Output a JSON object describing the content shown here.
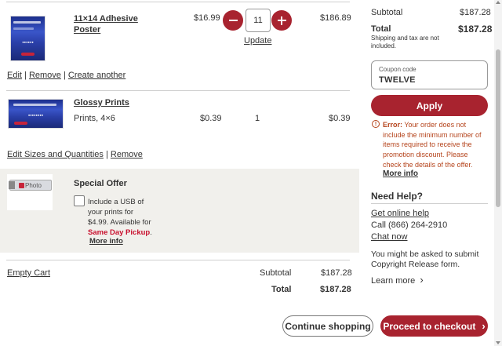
{
  "items": [
    {
      "name": "11×14 Adhesive Poster",
      "name_line1": "11×14 Adhesive",
      "name_line2": "Poster",
      "price": "$16.99",
      "quantity": "11",
      "total": "$186.89",
      "update_label": "Update",
      "actions": [
        "Edit",
        "Remove",
        "Create another"
      ]
    },
    {
      "name": "Glossy Prints",
      "subtitle": "Prints, 4×6",
      "price": "$0.39",
      "quantity": "1",
      "total": "$0.39",
      "actions": [
        "Edit Sizes and Quantities",
        "Remove"
      ]
    }
  ],
  "offer": {
    "badge": "Photo",
    "title": "Special Offer",
    "line1": "Include a USB of",
    "line2": "your prints for",
    "line3": "$4.99. Available for",
    "highlight": "Same Day Pickup",
    "highlight_suffix": ".",
    "more_info": "More info"
  },
  "cart_footer": {
    "empty_cart": "Empty Cart",
    "subtotal_label": "Subtotal",
    "subtotal_value": "$187.28",
    "total_label": "Total",
    "total_value": "$187.28"
  },
  "buttons": {
    "continue": "Continue shopping",
    "checkout": "Proceed to checkout"
  },
  "summary": {
    "subtotal_label": "Subtotal",
    "subtotal_value": "$187.28",
    "total_label": "Total",
    "total_value": "$187.28",
    "note_line1": "Shipping and tax are not",
    "note_line2": "included."
  },
  "coupon": {
    "label": "Coupon code",
    "value": "TWELVE",
    "apply": "Apply"
  },
  "error": {
    "prefix": "Error:",
    "line1": " Your order does not",
    "line2": "include the minimum number of",
    "line3": "items required to receive the",
    "line4": "promotion discount. Please",
    "line5": "check the details of the offer.",
    "link": "More info"
  },
  "help": {
    "title": "Need Help?",
    "online": "Get online help",
    "call": "Call (866) 264-2910",
    "chat": "Chat now",
    "copyright_line1": "You might be asked to submit",
    "copyright_line2": "Copyright Release form.",
    "learn_more": "Learn more"
  },
  "colors": {
    "accent": "#a8232f",
    "error": "#b5441c",
    "offer_bg": "#f1f0ec"
  }
}
